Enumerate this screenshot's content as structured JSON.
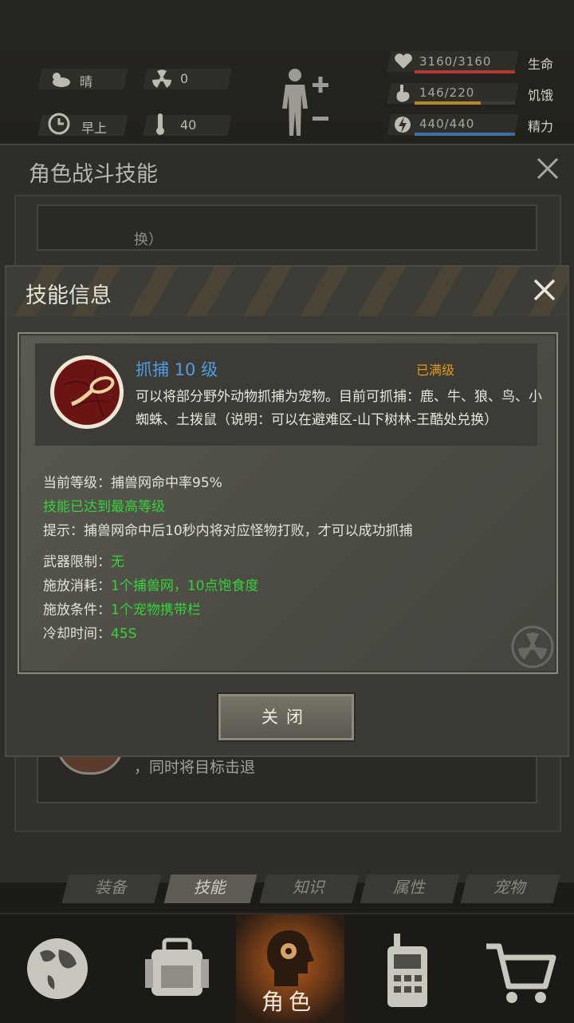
{
  "status": {
    "weather": "晴",
    "radiation": "0",
    "time_of_day": "早上",
    "temperature": "40"
  },
  "vitals": [
    {
      "value": "3160/3160",
      "label": "生命",
      "fill": 1.0,
      "color": "#b03a34"
    },
    {
      "value": "146/220",
      "label": "饥饿",
      "fill": 0.66,
      "color": "#b58a2c"
    },
    {
      "value": "440/440",
      "label": "精力",
      "fill": 1.0,
      "color": "#3e6ea6"
    }
  ],
  "background_panel": {
    "title": "角色战斗技能",
    "card1_text": "换）",
    "card2_text": "，同时将目标击退"
  },
  "dialog": {
    "title": "技能信息",
    "skill_name": "抓捕 10 级",
    "max_level": "已满级",
    "description": "可以将部分野外动物抓捕为宠物。目前可抓捕：鹿、牛、狼、鸟、小蜘蛛、土拨鼠（说明：可以在避难区-山下树林-王酷处兑换）",
    "current_level_label": "当前等级：",
    "current_level_value": "捕兽网命中率95%",
    "max_reached": "技能已达到最高等级",
    "tip": "提示：捕兽网命中后10秒内将对应怪物打败，才可以成功抓捕",
    "weapon_label": "武器限制：",
    "weapon_value": "无",
    "cost_label": "施放消耗：",
    "cost_value": "1个捕兽网，10点饱食度",
    "condition_label": "施放条件：",
    "condition_value": "1个宠物携带栏",
    "cooldown_label": "冷却时间：",
    "cooldown_value": "45S",
    "close_button": "关闭"
  },
  "sub_tabs": [
    "装备",
    "技能",
    "知识",
    "属性",
    "宠物"
  ],
  "nav": {
    "active_label": "角色",
    "items": [
      "world-map",
      "backpack",
      "character",
      "radio",
      "shop"
    ]
  },
  "colors": {
    "accent_blue": "#4e9de2",
    "accent_orange": "#e29a1c",
    "accent_green": "#35d23a"
  }
}
